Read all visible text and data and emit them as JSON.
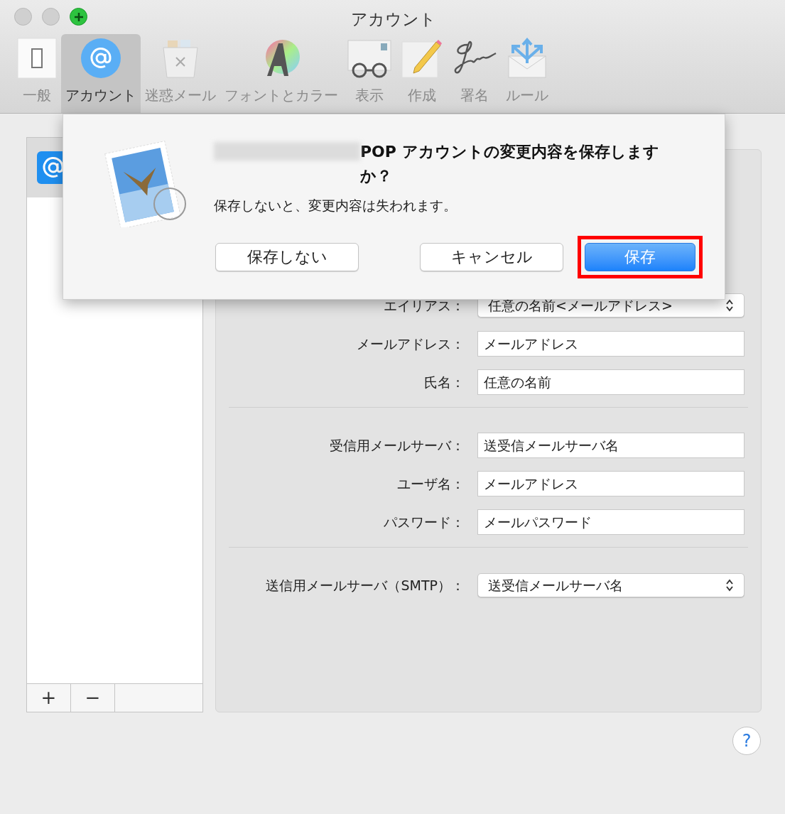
{
  "window": {
    "title": "アカウント"
  },
  "toolbar": [
    {
      "label": "一般",
      "selected": false,
      "kind": "general"
    },
    {
      "label": "アカウント",
      "selected": true,
      "kind": "accounts"
    },
    {
      "label": "迷惑メール",
      "selected": false,
      "kind": "junk"
    },
    {
      "label": "フォントとカラー",
      "selected": false,
      "kind": "fonts"
    },
    {
      "label": "表示",
      "selected": false,
      "kind": "viewing"
    },
    {
      "label": "作成",
      "selected": false,
      "kind": "composing"
    },
    {
      "label": "署名",
      "selected": false,
      "kind": "signatures"
    },
    {
      "label": "ルール",
      "selected": false,
      "kind": "rules"
    }
  ],
  "sidebar": {
    "buttons": [
      "+",
      "−"
    ]
  },
  "form": {
    "groups": [
      [
        {
          "label": "エイリアス：",
          "value": "任意の名前<メールアドレス>",
          "kind": "popup"
        },
        {
          "label": "メールアドレス：",
          "value": "メールアドレス",
          "kind": "text"
        },
        {
          "label": "氏名：",
          "value": "任意の名前",
          "kind": "text"
        }
      ],
      [
        {
          "label": "受信用メールサーバ：",
          "value": "送受信メールサーバ名",
          "kind": "text"
        },
        {
          "label": "ユーザ名：",
          "value": "メールアドレス",
          "kind": "text"
        },
        {
          "label": "パスワード：",
          "value": "メールパスワード",
          "kind": "text"
        }
      ],
      [
        {
          "label": "送信用メールサーバ（SMTP）：",
          "value": "送受信メールサーバ名",
          "kind": "popup"
        }
      ]
    ]
  },
  "dialog": {
    "title": "POP アカウントの変更内容を保存しますか？",
    "message": "保存しないと、変更内容は失われます。",
    "buttons": [
      {
        "label": "保存しない",
        "kind": "normal"
      },
      {
        "label": "キャンセル",
        "kind": "normal"
      },
      {
        "label": "保存",
        "kind": "default",
        "highlighted": true
      }
    ]
  },
  "help": "?"
}
